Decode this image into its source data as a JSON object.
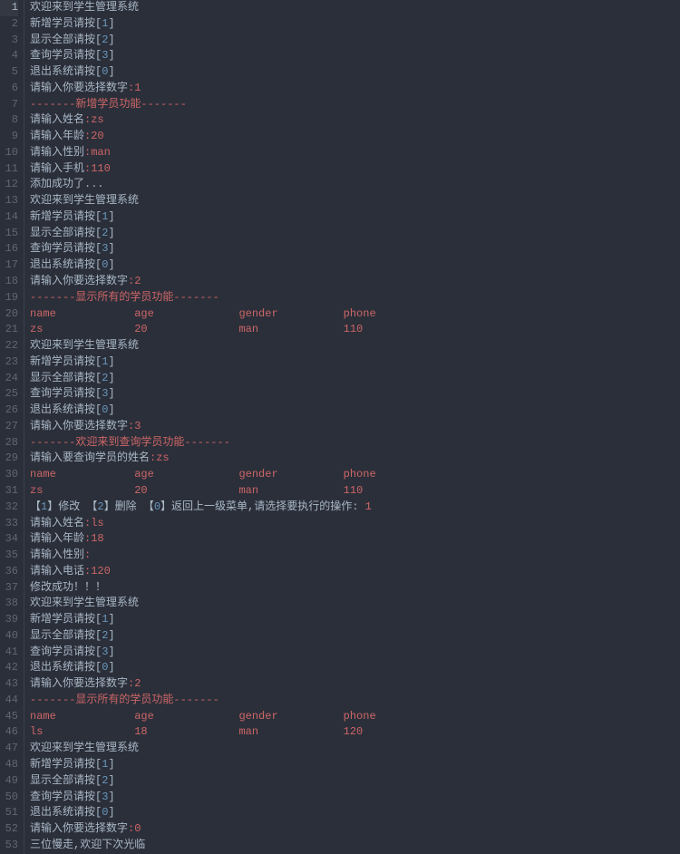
{
  "total_lines": 53,
  "highlight_line": 1,
  "lines": [
    [
      [
        "plain",
        "欢迎来到学生管理系统"
      ]
    ],
    [
      [
        "plain",
        "新增学员请按"
      ],
      [
        "brace",
        "["
      ],
      [
        "num",
        "1"
      ],
      [
        "brace",
        "]"
      ]
    ],
    [
      [
        "plain",
        "显示全部请按"
      ],
      [
        "brace",
        "["
      ],
      [
        "num",
        "2"
      ],
      [
        "brace",
        "]"
      ]
    ],
    [
      [
        "plain",
        "查询学员请按"
      ],
      [
        "brace",
        "["
      ],
      [
        "num",
        "3"
      ],
      [
        "brace",
        "]"
      ]
    ],
    [
      [
        "plain",
        "退出系统请按"
      ],
      [
        "brace",
        "["
      ],
      [
        "num",
        "0"
      ],
      [
        "brace",
        "]"
      ]
    ],
    [
      [
        "plain",
        "请输入你要选择数字"
      ],
      [
        "red",
        ":1"
      ]
    ],
    [
      [
        "red",
        "-------新增学员功能-------"
      ]
    ],
    [
      [
        "plain",
        "请输入姓名"
      ],
      [
        "red",
        ":zs"
      ]
    ],
    [
      [
        "plain",
        "请输入年龄"
      ],
      [
        "red",
        ":20"
      ]
    ],
    [
      [
        "plain",
        "请输入性别"
      ],
      [
        "red",
        ":man"
      ]
    ],
    [
      [
        "plain",
        "请输入手机"
      ],
      [
        "red",
        ":110"
      ]
    ],
    [
      [
        "plain",
        "添加成功了..."
      ]
    ],
    [
      [
        "plain",
        "欢迎来到学生管理系统"
      ]
    ],
    [
      [
        "plain",
        "新增学员请按"
      ],
      [
        "brace",
        "["
      ],
      [
        "num",
        "1"
      ],
      [
        "brace",
        "]"
      ]
    ],
    [
      [
        "plain",
        "显示全部请按"
      ],
      [
        "brace",
        "["
      ],
      [
        "num",
        "2"
      ],
      [
        "brace",
        "]"
      ]
    ],
    [
      [
        "plain",
        "查询学员请按"
      ],
      [
        "brace",
        "["
      ],
      [
        "num",
        "3"
      ],
      [
        "brace",
        "]"
      ]
    ],
    [
      [
        "plain",
        "退出系统请按"
      ],
      [
        "brace",
        "["
      ],
      [
        "num",
        "0"
      ],
      [
        "brace",
        "]"
      ]
    ],
    [
      [
        "plain",
        "请输入你要选择数字"
      ],
      [
        "red",
        ":2"
      ]
    ],
    [
      [
        "red",
        "-------显示所有的学员功能-------"
      ]
    ],
    [
      [
        "red",
        "name            age             gender          phone"
      ]
    ],
    [
      [
        "red",
        "zs              20              man             110"
      ]
    ],
    [
      [
        "plain",
        "欢迎来到学生管理系统"
      ]
    ],
    [
      [
        "plain",
        "新增学员请按"
      ],
      [
        "brace",
        "["
      ],
      [
        "num",
        "1"
      ],
      [
        "brace",
        "]"
      ]
    ],
    [
      [
        "plain",
        "显示全部请按"
      ],
      [
        "brace",
        "["
      ],
      [
        "num",
        "2"
      ],
      [
        "brace",
        "]"
      ]
    ],
    [
      [
        "plain",
        "查询学员请按"
      ],
      [
        "brace",
        "["
      ],
      [
        "num",
        "3"
      ],
      [
        "brace",
        "]"
      ]
    ],
    [
      [
        "plain",
        "退出系统请按"
      ],
      [
        "brace",
        "["
      ],
      [
        "num",
        "0"
      ],
      [
        "brace",
        "]"
      ]
    ],
    [
      [
        "plain",
        "请输入你要选择数字"
      ],
      [
        "red",
        ":3"
      ]
    ],
    [
      [
        "red",
        "-------欢迎来到查询学员功能-------"
      ]
    ],
    [
      [
        "plain",
        "请输入要查询学员的姓名"
      ],
      [
        "red",
        ":zs"
      ]
    ],
    [
      [
        "red",
        "name            age             gender          phone"
      ]
    ],
    [
      [
        "red",
        "zs              20              man             110"
      ]
    ],
    [
      [
        "plain",
        "【"
      ],
      [
        "num",
        "1"
      ],
      [
        "plain",
        "】修改 【"
      ],
      [
        "num",
        "2"
      ],
      [
        "plain",
        "】删除 【"
      ],
      [
        "num",
        "0"
      ],
      [
        "plain",
        "】返回上一级菜单,请选择要执行的操作:"
      ],
      [
        "red",
        " 1"
      ]
    ],
    [
      [
        "plain",
        "请输入姓名"
      ],
      [
        "red",
        ":ls"
      ]
    ],
    [
      [
        "plain",
        "请输入年龄"
      ],
      [
        "red",
        ":18"
      ]
    ],
    [
      [
        "plain",
        "请输入性别"
      ],
      [
        "red",
        ":"
      ]
    ],
    [
      [
        "plain",
        "请输入电话"
      ],
      [
        "red",
        ":120"
      ]
    ],
    [
      [
        "plain",
        "修改成功！！！"
      ]
    ],
    [
      [
        "plain",
        "欢迎来到学生管理系统"
      ]
    ],
    [
      [
        "plain",
        "新增学员请按"
      ],
      [
        "brace",
        "["
      ],
      [
        "num",
        "1"
      ],
      [
        "brace",
        "]"
      ]
    ],
    [
      [
        "plain",
        "显示全部请按"
      ],
      [
        "brace",
        "["
      ],
      [
        "num",
        "2"
      ],
      [
        "brace",
        "]"
      ]
    ],
    [
      [
        "plain",
        "查询学员请按"
      ],
      [
        "brace",
        "["
      ],
      [
        "num",
        "3"
      ],
      [
        "brace",
        "]"
      ]
    ],
    [
      [
        "plain",
        "退出系统请按"
      ],
      [
        "brace",
        "["
      ],
      [
        "num",
        "0"
      ],
      [
        "brace",
        "]"
      ]
    ],
    [
      [
        "plain",
        "请输入你要选择数字"
      ],
      [
        "red",
        ":2"
      ]
    ],
    [
      [
        "red",
        "-------显示所有的学员功能-------"
      ]
    ],
    [
      [
        "red",
        "name            age             gender          phone"
      ]
    ],
    [
      [
        "red",
        "ls              18              man             120"
      ]
    ],
    [
      [
        "plain",
        "欢迎来到学生管理系统"
      ]
    ],
    [
      [
        "plain",
        "新增学员请按"
      ],
      [
        "brace",
        "["
      ],
      [
        "num",
        "1"
      ],
      [
        "brace",
        "]"
      ]
    ],
    [
      [
        "plain",
        "显示全部请按"
      ],
      [
        "brace",
        "["
      ],
      [
        "num",
        "2"
      ],
      [
        "brace",
        "]"
      ]
    ],
    [
      [
        "plain",
        "查询学员请按"
      ],
      [
        "brace",
        "["
      ],
      [
        "num",
        "3"
      ],
      [
        "brace",
        "]"
      ]
    ],
    [
      [
        "plain",
        "退出系统请按"
      ],
      [
        "brace",
        "["
      ],
      [
        "num",
        "0"
      ],
      [
        "brace",
        "]"
      ]
    ],
    [
      [
        "plain",
        "请输入你要选择数字"
      ],
      [
        "red",
        ":0"
      ]
    ],
    [
      [
        "plain",
        "三位慢走,欢迎下次光临"
      ]
    ]
  ]
}
